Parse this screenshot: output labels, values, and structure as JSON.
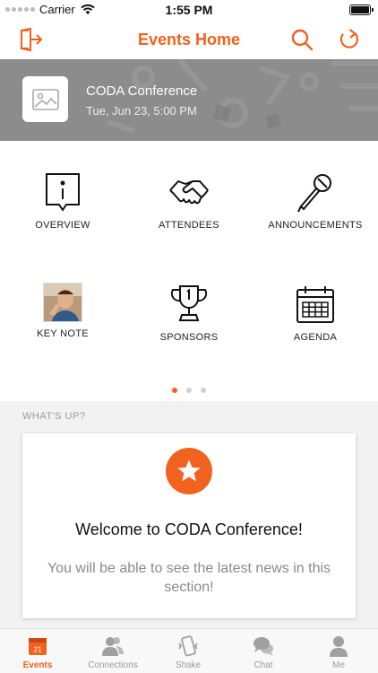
{
  "status": {
    "carrier": "Carrier",
    "time": "1:55 PM"
  },
  "nav": {
    "title": "Events Home"
  },
  "hero": {
    "title": "CODA Conference",
    "date": "Tue, Jun 23, 5:00 PM"
  },
  "grid": {
    "tiles": [
      {
        "label": "OVERVIEW",
        "icon": "info-book-icon"
      },
      {
        "label": "ATTENDEES",
        "icon": "handshake-icon"
      },
      {
        "label": "ANNOUNCEMENTS",
        "icon": "microphone-icon"
      },
      {
        "label": "KEY NOTE",
        "icon": "speaker-photo"
      },
      {
        "label": "SPONSORS",
        "icon": "trophy-icon"
      },
      {
        "label": "AGENDA",
        "icon": "calendar-icon"
      }
    ],
    "page_count": 3,
    "active_page": 1
  },
  "whats_up": {
    "header": "WHAT'S UP?",
    "card_title": "Welcome to CODA Conference!",
    "card_text": "You will be able to see the latest news in this section!"
  },
  "tabs": [
    {
      "label": "Events",
      "icon": "calendar-day-icon",
      "badge": "21",
      "active": true
    },
    {
      "label": "Connections",
      "icon": "people-icon",
      "active": false
    },
    {
      "label": "Shake",
      "icon": "shake-phone-icon",
      "active": false
    },
    {
      "label": "Chat",
      "icon": "chat-bubbles-icon",
      "active": false
    },
    {
      "label": "Me",
      "icon": "person-icon",
      "active": false
    }
  ],
  "colors": {
    "accent": "#f0621e",
    "hero_bg": "#8c8c8c",
    "section_bg": "#f2f2f2"
  }
}
